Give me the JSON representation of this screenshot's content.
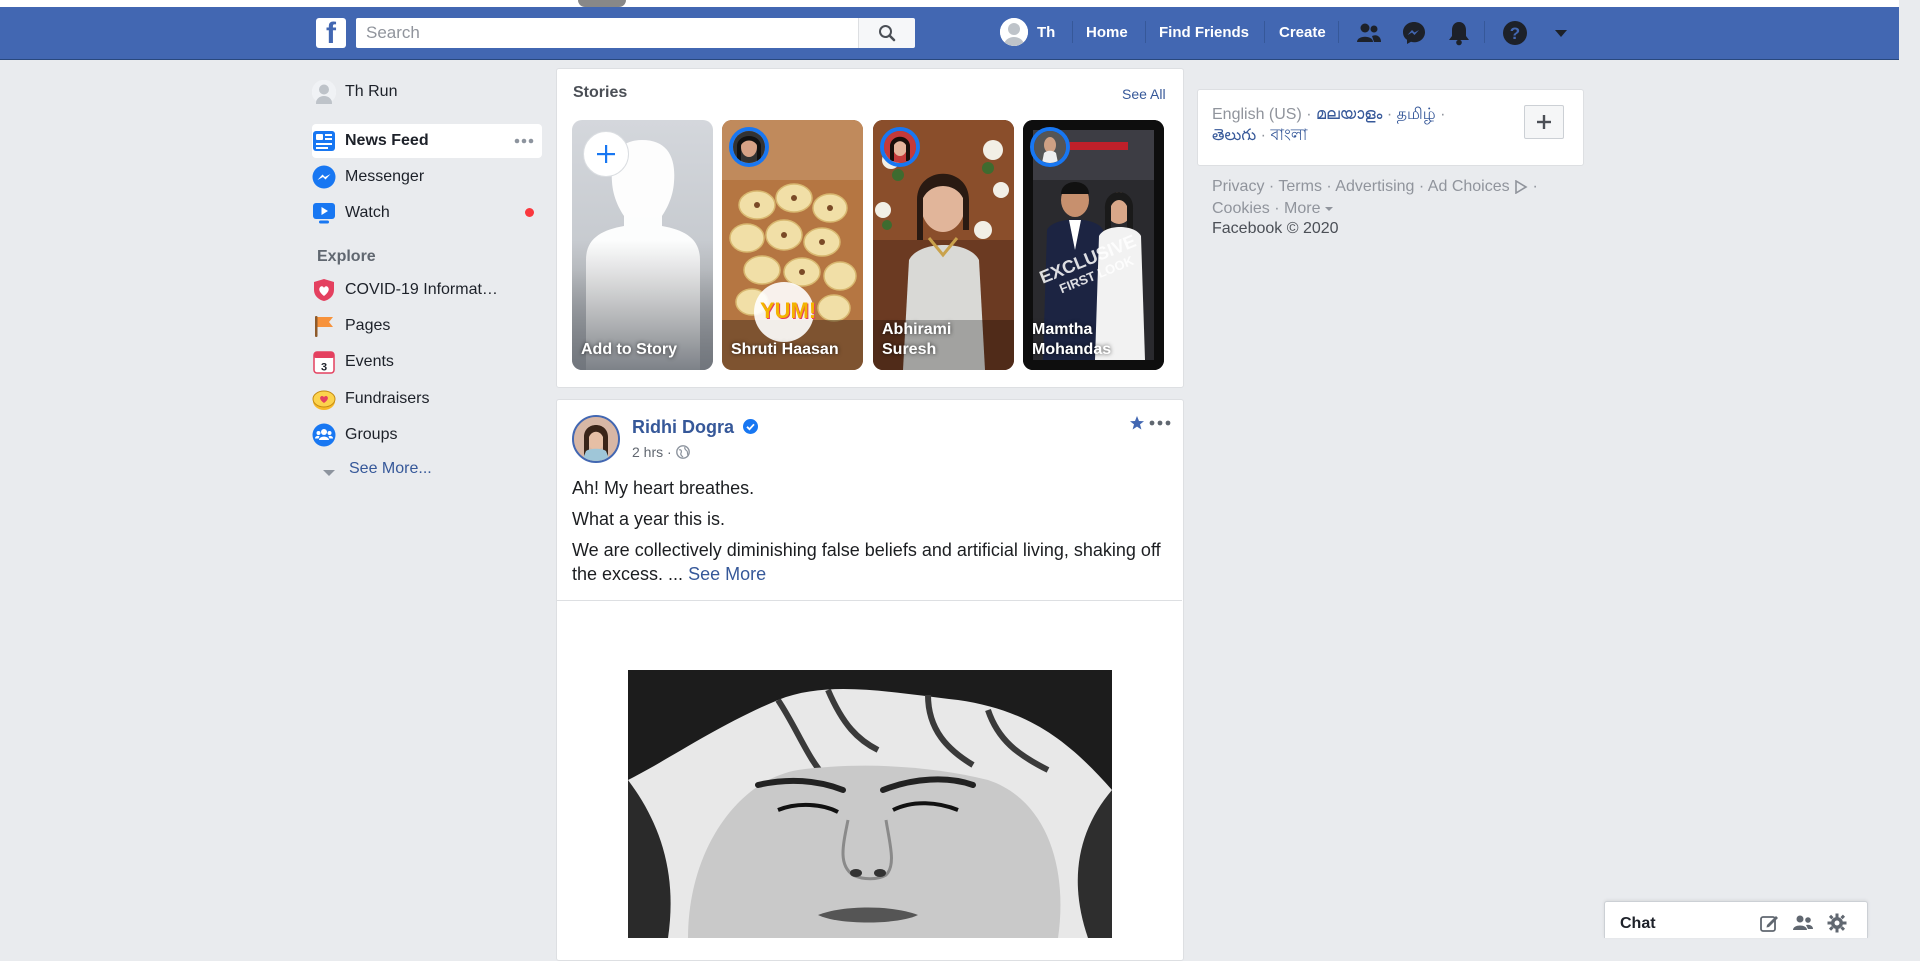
{
  "header": {
    "logo": "f",
    "search_placeholder": "Search",
    "nav": {
      "profile_name": "Th",
      "home": "Home",
      "find_friends": "Find Friends",
      "create": "Create"
    },
    "icons": [
      "friend-requests-icon",
      "messenger-icon",
      "notifications-icon",
      "help-icon",
      "account-menu-icon"
    ]
  },
  "sidebar": {
    "profile": "Th Run",
    "items": [
      {
        "label": "News Feed",
        "icon": "news-feed-icon",
        "color": "#1877f2"
      },
      {
        "label": "Messenger",
        "icon": "messenger-icon",
        "color": "#1877f2"
      },
      {
        "label": "Watch",
        "icon": "watch-icon",
        "color": "#1877f2",
        "badge_color": "#fa383e"
      }
    ],
    "explore_heading": "Explore",
    "explore": [
      {
        "label": "COVID-19 Informat…",
        "icon": "heart-shield-icon",
        "color": "#e4405f"
      },
      {
        "label": "Pages",
        "icon": "flag-icon",
        "color": "#f7923b"
      },
      {
        "label": "Events",
        "icon": "calendar-icon",
        "color": "#e4405f",
        "calendar_day": "3"
      },
      {
        "label": "Fundraisers",
        "icon": "fundraiser-icon",
        "color": "#f7b928"
      },
      {
        "label": "Groups",
        "icon": "groups-icon",
        "color": "#1877f2"
      }
    ],
    "see_more": "See More..."
  },
  "stories": {
    "title": "Stories",
    "see_all": "See All",
    "items": [
      {
        "name": "Add to Story"
      },
      {
        "name": "Shruti Haasan",
        "sticker": "YUM!"
      },
      {
        "name": "Abhirami Suresh"
      },
      {
        "name": "Mamtha Mohandas",
        "overlay": [
          "EXCLUSIVE",
          "FIRST LOOK"
        ]
      }
    ]
  },
  "post": {
    "author": "Ridhi Dogra",
    "time": "2 hrs",
    "separator": "·",
    "lines": [
      "Ah! My heart breathes.",
      "What a year this is.",
      "We are collectively diminishing false beliefs and artificial living, shaking off the excess. ..."
    ],
    "see_more": "See More"
  },
  "right": {
    "languages": {
      "current": "English (US)",
      "others": [
        "മലയാളം",
        "தமிழ்",
        "తెలుగు",
        "বাংলা"
      ],
      "sep": "·"
    },
    "footer": {
      "links": [
        "Privacy",
        "Terms",
        "Advertising",
        "Ad Choices",
        "Cookies",
        "More"
      ],
      "sep": "·",
      "copyright": "Facebook © 2020"
    }
  },
  "chat": {
    "label": "Chat",
    "icons": [
      "new-message-icon",
      "create-group-icon",
      "chat-settings-icon"
    ]
  },
  "colors": {
    "brand": "#4267b2",
    "link": "#365899",
    "background": "#e9ebee",
    "story_ring": "#1877f2"
  }
}
